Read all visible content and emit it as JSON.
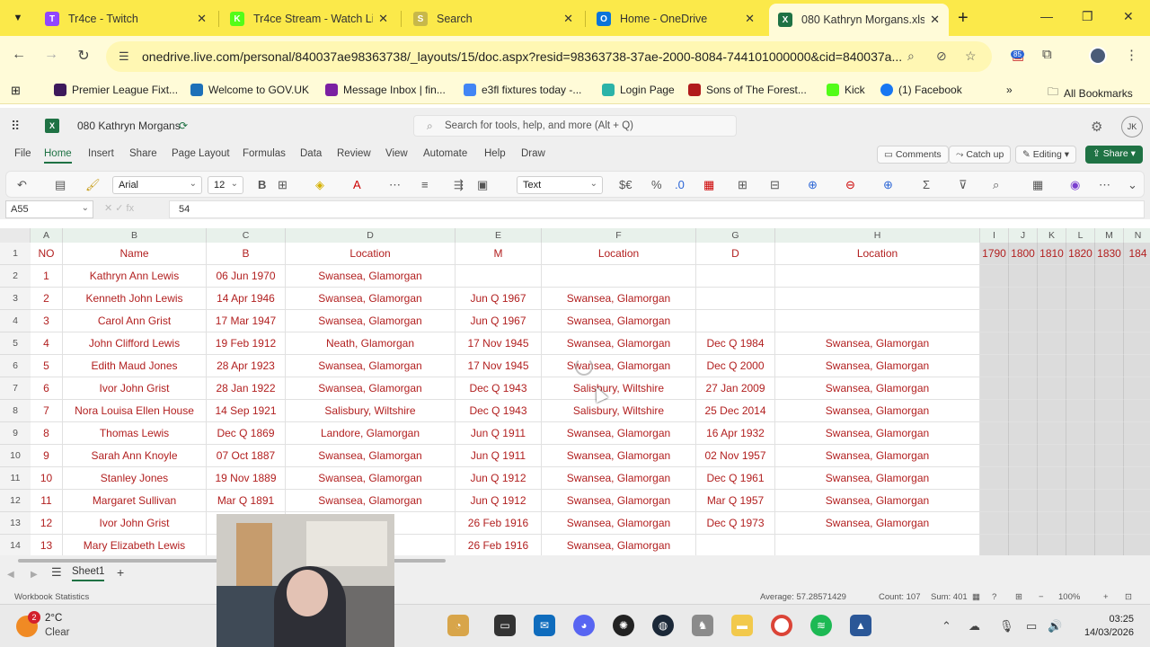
{
  "browser": {
    "tabs": [
      {
        "label": "Tr4ce - Twitch",
        "color": "#9146ff",
        "glyph": "T"
      },
      {
        "label": "Tr4ce Stream - Watch Live",
        "color": "#53fc18",
        "glyph": "K"
      },
      {
        "label": "Search",
        "color": "#c7b84a",
        "glyph": "S"
      },
      {
        "label": "Home - OneDrive",
        "color": "#0a74da",
        "glyph": "O"
      },
      {
        "label": "080 Kathryn Morgans.xlsx",
        "color": "#1f7244",
        "glyph": "X"
      }
    ],
    "url": "onedrive.live.com/personal/840037ae98363738/_layouts/15/doc.aspx?resid=98363738-37ae-2000-8084-744101000000&cid=840037a...",
    "extension_badge": "85",
    "bookmarks": [
      {
        "label": "Premier League Fixt...",
        "color": "#3d195b"
      },
      {
        "label": "Welcome to GOV.UK",
        "color": "#1d70b8"
      },
      {
        "label": "Message Inbox | fin...",
        "color": "#7b1fa2"
      },
      {
        "label": "e3fl fixtures today -...",
        "color": "#4285f4"
      },
      {
        "label": "Login Page",
        "color": "#2bb3a8"
      },
      {
        "label": "Sons of The Forest...",
        "color": "#b11b1b"
      },
      {
        "label": "Kick",
        "color": "#53fc18"
      },
      {
        "label": "(1) Facebook",
        "color": "#1877f2"
      }
    ],
    "all_bookmarks": "All Bookmarks"
  },
  "excel": {
    "doc_title": "080 Kathryn Morgans",
    "search_placeholder": "Search for tools, help, and more (Alt + Q)",
    "avatar_initials": "JK",
    "ribbon_tabs": [
      "File",
      "Home",
      "Insert",
      "Share",
      "Page Layout",
      "Formulas",
      "Data",
      "Review",
      "View",
      "Automate",
      "Help",
      "Draw"
    ],
    "comments": "Comments",
    "catch_up": "Catch up",
    "editing": "Editing",
    "share": "Share",
    "font_name": "Arial",
    "font_size": "12",
    "number_format": "Text",
    "name_box": "A55",
    "formula_value": "54",
    "columns": [
      "A",
      "B",
      "C",
      "D",
      "E",
      "F",
      "G",
      "H",
      "I",
      "J",
      "K",
      "L",
      "M",
      "N"
    ],
    "header_row": [
      "NO",
      "Name",
      "B",
      "Location",
      "M",
      "Location",
      "D",
      "Location",
      "1790",
      "1800",
      "1810",
      "1820",
      "1830",
      "184"
    ],
    "row_numbers": [
      "1",
      "2",
      "3",
      "4",
      "5",
      "6",
      "7",
      "8",
      "9",
      "10",
      "11",
      "12",
      "13",
      "14"
    ],
    "rows": [
      [
        "1",
        "Kathryn Ann Lewis",
        "06 Jun 1970",
        "Swansea, Glamorgan",
        "",
        "",
        "",
        ""
      ],
      [
        "2",
        "Kenneth John Lewis",
        "14 Apr 1946",
        "Swansea, Glamorgan",
        "Jun Q 1967",
        "Swansea, Glamorgan",
        "",
        ""
      ],
      [
        "3",
        "Carol Ann Grist",
        "17 Mar 1947",
        "Swansea, Glamorgan",
        "Jun Q 1967",
        "Swansea, Glamorgan",
        "",
        ""
      ],
      [
        "4",
        "John Clifford Lewis",
        "19 Feb 1912",
        "Neath, Glamorgan",
        "17 Nov 1945",
        "Swansea, Glamorgan",
        "Dec Q 1984",
        "Swansea, Glamorgan"
      ],
      [
        "5",
        "Edith Maud Jones",
        "28 Apr 1923",
        "Swansea, Glamorgan",
        "17 Nov 1945",
        "Swansea, Glamorgan",
        "Dec Q 2000",
        "Swansea, Glamorgan"
      ],
      [
        "6",
        "Ivor John Grist",
        "28 Jan 1922",
        "Swansea, Glamorgan",
        "Dec Q 1943",
        "Salisbury, Wiltshire",
        "27 Jan 2009",
        "Swansea, Glamorgan"
      ],
      [
        "7",
        "Nora Louisa Ellen House",
        "14 Sep 1921",
        "Salisbury, Wiltshire",
        "Dec Q 1943",
        "Salisbury, Wiltshire",
        "25 Dec 2014",
        "Swansea, Glamorgan"
      ],
      [
        "8",
        "Thomas Lewis",
        "Dec Q 1869",
        "Landore, Glamorgan",
        "Jun Q 1911",
        "Swansea, Glamorgan",
        "16 Apr 1932",
        "Swansea, Glamorgan"
      ],
      [
        "9",
        "Sarah Ann Knoyle",
        "07 Oct 1887",
        "Swansea, Glamorgan",
        "Jun Q 1911",
        "Swansea, Glamorgan",
        "02 Nov 1957",
        "Swansea, Glamorgan"
      ],
      [
        "10",
        "Stanley Jones",
        "19 Nov 1889",
        "Swansea, Glamorgan",
        "Jun Q 1912",
        "Swansea, Glamorgan",
        "Dec Q 1961",
        "Swansea, Glamorgan"
      ],
      [
        "11",
        "Margaret Sullivan",
        "Mar Q 1891",
        "Swansea, Glamorgan",
        "Jun Q 1912",
        "Swansea, Glamorgan",
        "Mar Q 1957",
        "Swansea, Glamorgan"
      ],
      [
        "12",
        "Ivor John Grist",
        "",
        "organ",
        "26 Feb 1916",
        "Swansea, Glamorgan",
        "Dec Q 1973",
        "Swansea, Glamorgan"
      ],
      [
        "13",
        "Mary Elizabeth Lewis",
        "",
        "organ",
        "26 Feb 1916",
        "Swansea, Glamorgan",
        "",
        ""
      ]
    ],
    "sheet_name": "Sheet1",
    "status": {
      "workbook_stats": "Workbook Statistics",
      "average": "Average: 57.28571429",
      "count": "Count: 107",
      "sum": "Sum: 401",
      "zoom": "100%"
    }
  },
  "taskbar": {
    "badge": "2",
    "temp": "2°C",
    "condition": "Clear",
    "time": "03:25",
    "date": "14/03/2026"
  }
}
